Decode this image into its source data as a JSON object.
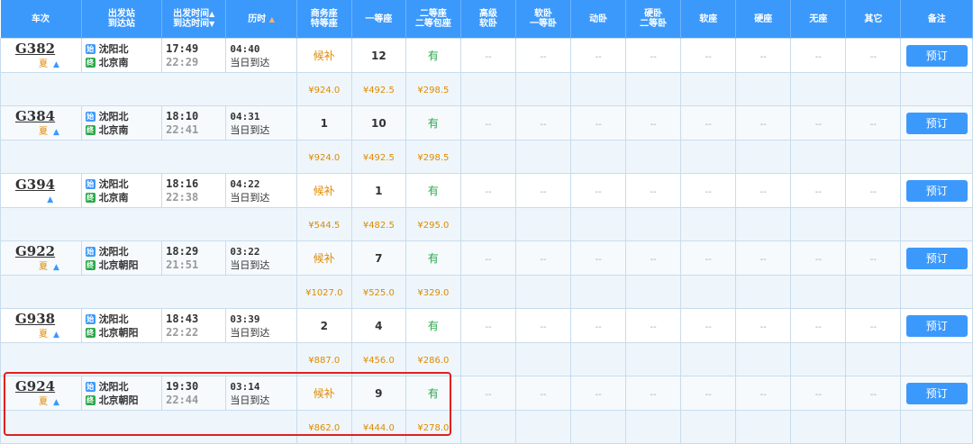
{
  "header": {
    "train": "车次",
    "from_station": "出发站",
    "to_station": "到达站",
    "dep_time": "出发时间",
    "arr_time": "到达时间",
    "duration": "历时",
    "biz_1": "商务座",
    "biz_2": "特等座",
    "first": "一等座",
    "second_1": "二等座",
    "second_2": "二等包座",
    "hs_1": "高级",
    "hs_2": "软卧",
    "sleeper_1": "软卧",
    "sleeper_2": "一等卧",
    "dongwo": "动卧",
    "hard_1": "硬卧",
    "hard_2": "二等卧",
    "soft_seat": "软座",
    "hard_seat": "硬座",
    "no_seat": "无座",
    "other": "其它",
    "remark": "备注",
    "sort_up": "▲",
    "sort_down": "▼"
  },
  "labels": {
    "summer": "夏",
    "start_badge": "始",
    "end_badge": "终",
    "same_day": "当日到达",
    "book": "预订",
    "dash": "--",
    "arrow": "▲"
  },
  "trains": [
    {
      "no": "G382",
      "summer": true,
      "from": "沈阳北",
      "to": "北京南",
      "dep": "17:49",
      "arr": "22:29",
      "dur": "04:40",
      "biz": "候补",
      "first": "12",
      "second": "有",
      "p_biz": "¥924.0",
      "p_first": "¥492.5",
      "p_second": "¥298.5"
    },
    {
      "no": "G384",
      "summer": true,
      "from": "沈阳北",
      "to": "北京南",
      "dep": "18:10",
      "arr": "22:41",
      "dur": "04:31",
      "biz": "1",
      "first": "10",
      "second": "有",
      "p_biz": "¥924.0",
      "p_first": "¥492.5",
      "p_second": "¥298.5"
    },
    {
      "no": "G394",
      "summer": false,
      "from": "沈阳北",
      "to": "北京南",
      "dep": "18:16",
      "arr": "22:38",
      "dur": "04:22",
      "biz": "候补",
      "first": "1",
      "second": "有",
      "p_biz": "¥544.5",
      "p_first": "¥482.5",
      "p_second": "¥295.0"
    },
    {
      "no": "G922",
      "summer": true,
      "from": "沈阳北",
      "to": "北京朝阳",
      "dep": "18:29",
      "arr": "21:51",
      "dur": "03:22",
      "biz": "候补",
      "first": "7",
      "second": "有",
      "p_biz": "¥1027.0",
      "p_first": "¥525.0",
      "p_second": "¥329.0"
    },
    {
      "no": "G938",
      "summer": true,
      "from": "沈阳北",
      "to": "北京朝阳",
      "dep": "18:43",
      "arr": "22:22",
      "dur": "03:39",
      "biz": "2",
      "first": "4",
      "second": "有",
      "p_biz": "¥887.0",
      "p_first": "¥456.0",
      "p_second": "¥286.0"
    },
    {
      "no": "G924",
      "summer": true,
      "from": "沈阳北",
      "to": "北京朝阳",
      "dep": "19:30",
      "arr": "22:44",
      "dur": "03:14",
      "biz": "候补",
      "first": "9",
      "second": "有",
      "p_biz": "¥862.0",
      "p_first": "¥444.0",
      "p_second": "¥278.0"
    }
  ],
  "colors": {
    "header_bg": "#3b99fc",
    "accent": "#3b99fc",
    "wait": "#e08a00",
    "available": "#2aa84a",
    "highlight": "#e02020"
  }
}
